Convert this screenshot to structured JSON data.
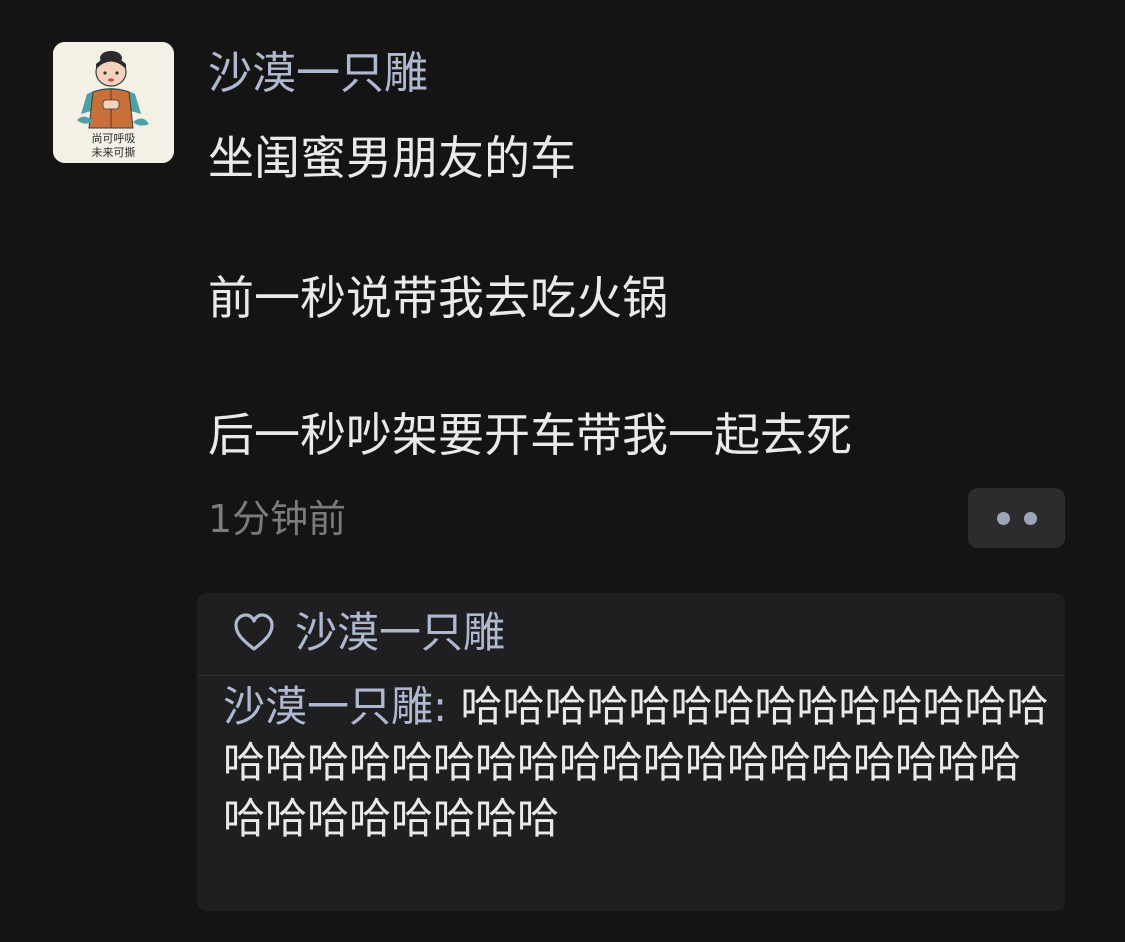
{
  "post": {
    "username": "沙漠一只雕",
    "avatar_caption": [
      "尚可呼吸",
      "未来可撕"
    ],
    "lines": [
      "坐闺蜜男朋友的车",
      "前一秒说带我去吃火锅",
      "后一秒吵架要开车带我一起去死"
    ],
    "timestamp": "1分钟前"
  },
  "more_button": {
    "icon": "more-dots-icon"
  },
  "comments": {
    "like_icon": "heart-icon",
    "liked_by": "沙漠一只雕",
    "items": [
      {
        "author": "沙漠一只雕",
        "separator": ": ",
        "text": "哈哈哈哈哈哈哈哈哈哈哈哈哈哈哈哈哈哈哈哈哈哈哈哈哈哈哈哈哈哈哈哈哈哈哈哈哈哈哈哈哈"
      }
    ]
  },
  "colors": {
    "background": "#141414",
    "name_blue": "#aeb8cf",
    "text": "#eaeaea",
    "muted": "#7b7b7b",
    "panel": "#1f1f21"
  }
}
